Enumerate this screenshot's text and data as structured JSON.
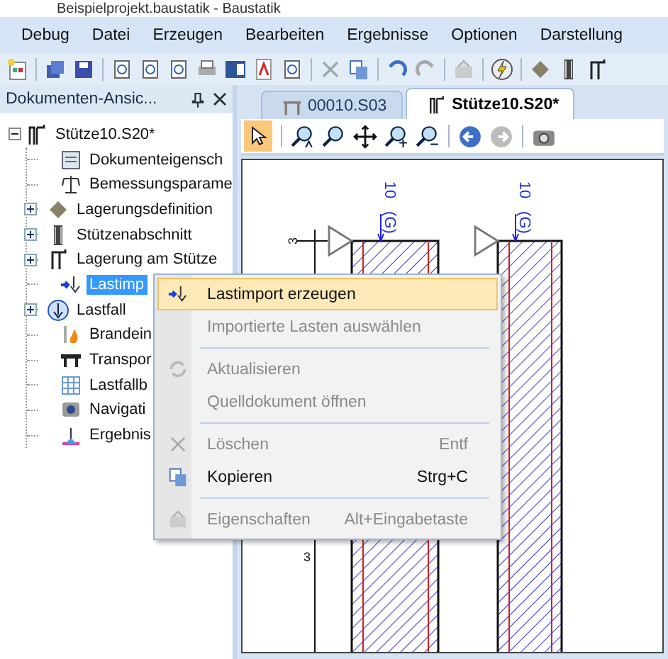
{
  "window": {
    "title": "Beispielprojekt.baustatik - Baustatik"
  },
  "menu_bar": [
    "Debug",
    "Datei",
    "Erzeugen",
    "Bearbeiten",
    "Ergebnisse",
    "Optionen",
    "Darstellung"
  ],
  "document_panel": {
    "title": "Dokumenten-Ansic...",
    "tree": [
      {
        "label": "Stütze10.S20*",
        "expanded": true,
        "selected": false,
        "children": [
          {
            "label": "Dokumenteigensch",
            "has_children": false,
            "selected": false
          },
          {
            "label": "Bemessungsparame",
            "has_children": false,
            "selected": false
          },
          {
            "label": "Lagerungsdefinition",
            "has_children": true,
            "expanded": false,
            "selected": false
          },
          {
            "label": "Stützenabschnitt",
            "has_children": true,
            "expanded": false,
            "selected": false
          },
          {
            "label": "Lagerung am Stütze",
            "has_children": true,
            "expanded": false,
            "selected": false
          },
          {
            "label": "Lastimp",
            "has_children": false,
            "selected": true
          },
          {
            "label": "Lastfall",
            "has_children": true,
            "expanded": false,
            "selected": false
          },
          {
            "label": "Brandein",
            "has_children": false,
            "selected": false
          },
          {
            "label": "Transpor",
            "has_children": false,
            "selected": false
          },
          {
            "label": "Lastfallb",
            "has_children": false,
            "selected": false
          },
          {
            "label": "Navigati",
            "has_children": false,
            "selected": false
          },
          {
            "label": "Ergebnis",
            "has_children": false,
            "selected": false
          }
        ]
      }
    ]
  },
  "tabs": [
    {
      "label": "00010.S03",
      "selected": false
    },
    {
      "label": "Stütze10.S20*",
      "selected": true
    }
  ],
  "drawing": {
    "loads": [
      {
        "value": "10",
        "case": "(G)"
      },
      {
        "value": "10",
        "case": "(G)"
      }
    ],
    "dimension_labels": [
      "3",
      "3"
    ]
  },
  "context_menu": [
    {
      "kind": "item",
      "label": "Lastimport erzeugen",
      "disabled": false,
      "selected": true
    },
    {
      "kind": "item",
      "label": "Importierte Lasten auswählen",
      "disabled": true,
      "selected": false
    },
    {
      "kind": "separator"
    },
    {
      "kind": "item",
      "label": "Aktualisieren",
      "disabled": true,
      "selected": false
    },
    {
      "kind": "item",
      "label": "Quelldokument öffnen",
      "disabled": true,
      "selected": false
    },
    {
      "kind": "separator"
    },
    {
      "kind": "item",
      "label": "Löschen",
      "shortcut": "Entf",
      "disabled": true,
      "selected": false
    },
    {
      "kind": "item",
      "label": "Kopieren",
      "shortcut": "Strg+C",
      "disabled": false,
      "selected": false
    },
    {
      "kind": "separator"
    },
    {
      "kind": "item",
      "label": "Eigenschaften",
      "shortcut": "Alt+Eingabetaste",
      "disabled": true,
      "selected": false
    }
  ]
}
